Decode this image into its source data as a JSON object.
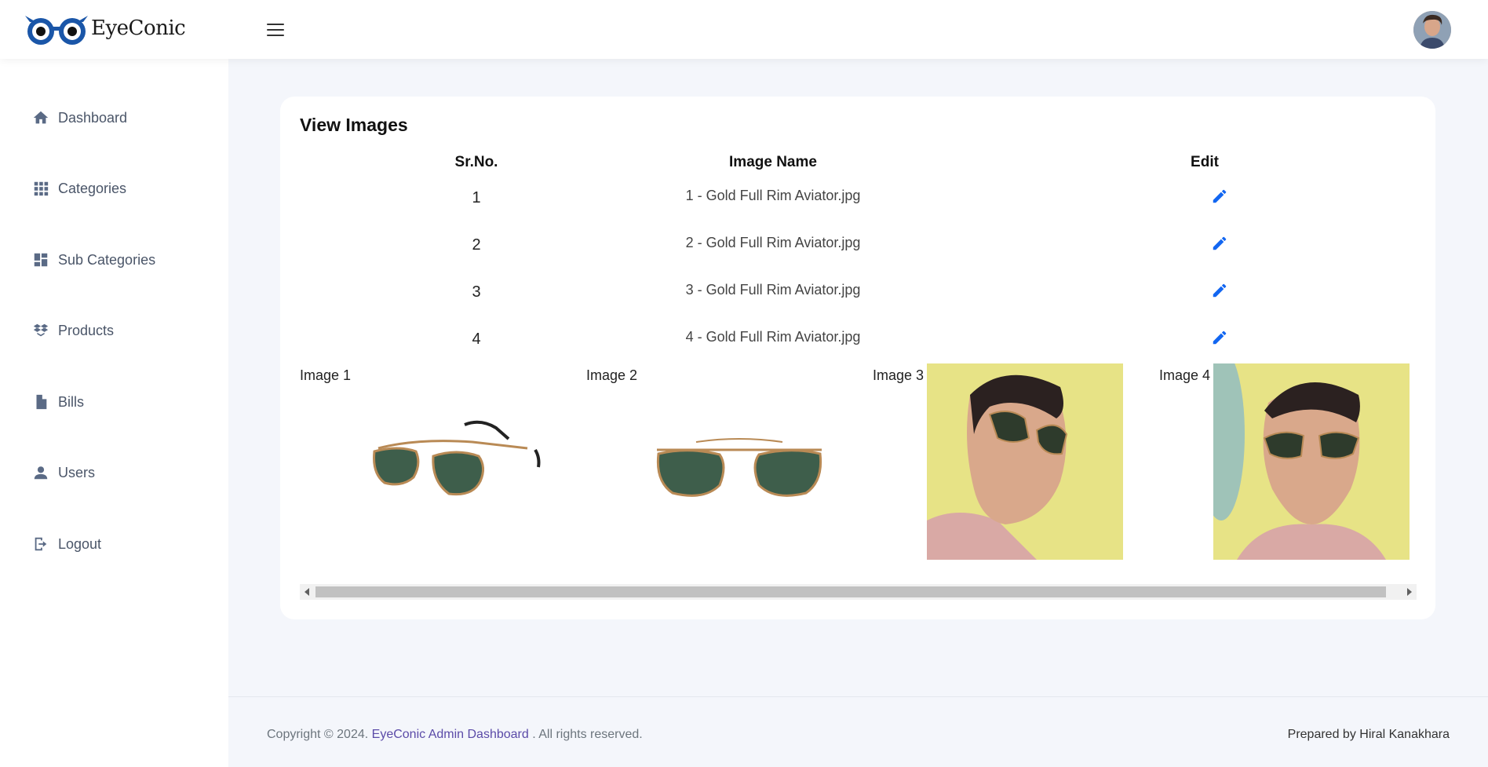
{
  "header": {
    "brand": "EyeConic"
  },
  "sidebar": {
    "items": [
      {
        "label": "Dashboard",
        "icon": "home-icon"
      },
      {
        "label": "Categories",
        "icon": "grid-icon"
      },
      {
        "label": "Sub Categories",
        "icon": "dashboard-tiles-icon"
      },
      {
        "label": "Products",
        "icon": "boxes-icon"
      },
      {
        "label": "Bills",
        "icon": "file-icon"
      },
      {
        "label": "Users",
        "icon": "user-icon"
      },
      {
        "label": "Logout",
        "icon": "logout-icon"
      }
    ]
  },
  "main": {
    "title": "View Images",
    "columns": [
      "Sr.No.",
      "Image Name",
      "Edit"
    ],
    "rows": [
      {
        "sr": "1",
        "name": "1 - Gold Full Rim Aviator.jpg"
      },
      {
        "sr": "2",
        "name": "2 - Gold Full Rim Aviator.jpg"
      },
      {
        "sr": "3",
        "name": "3 - Gold Full Rim Aviator.jpg"
      },
      {
        "sr": "4",
        "name": "4 - Gold Full Rim Aviator.jpg"
      }
    ],
    "images": [
      {
        "label": "Image 1"
      },
      {
        "label": "Image 2"
      },
      {
        "label": "Image 3"
      },
      {
        "label": "Image 4"
      }
    ]
  },
  "footer": {
    "copyright_prefix": "Copyright © 2024.",
    "link_text": "EyeConic Admin Dashboard",
    "copyright_suffix": ". All rights reserved.",
    "credit": "Prepared by Hiral Kanakhara"
  },
  "colors": {
    "accent_blue": "#1266f1",
    "link_purple": "#5b4ba8",
    "page_bg": "#f4f6fb"
  }
}
